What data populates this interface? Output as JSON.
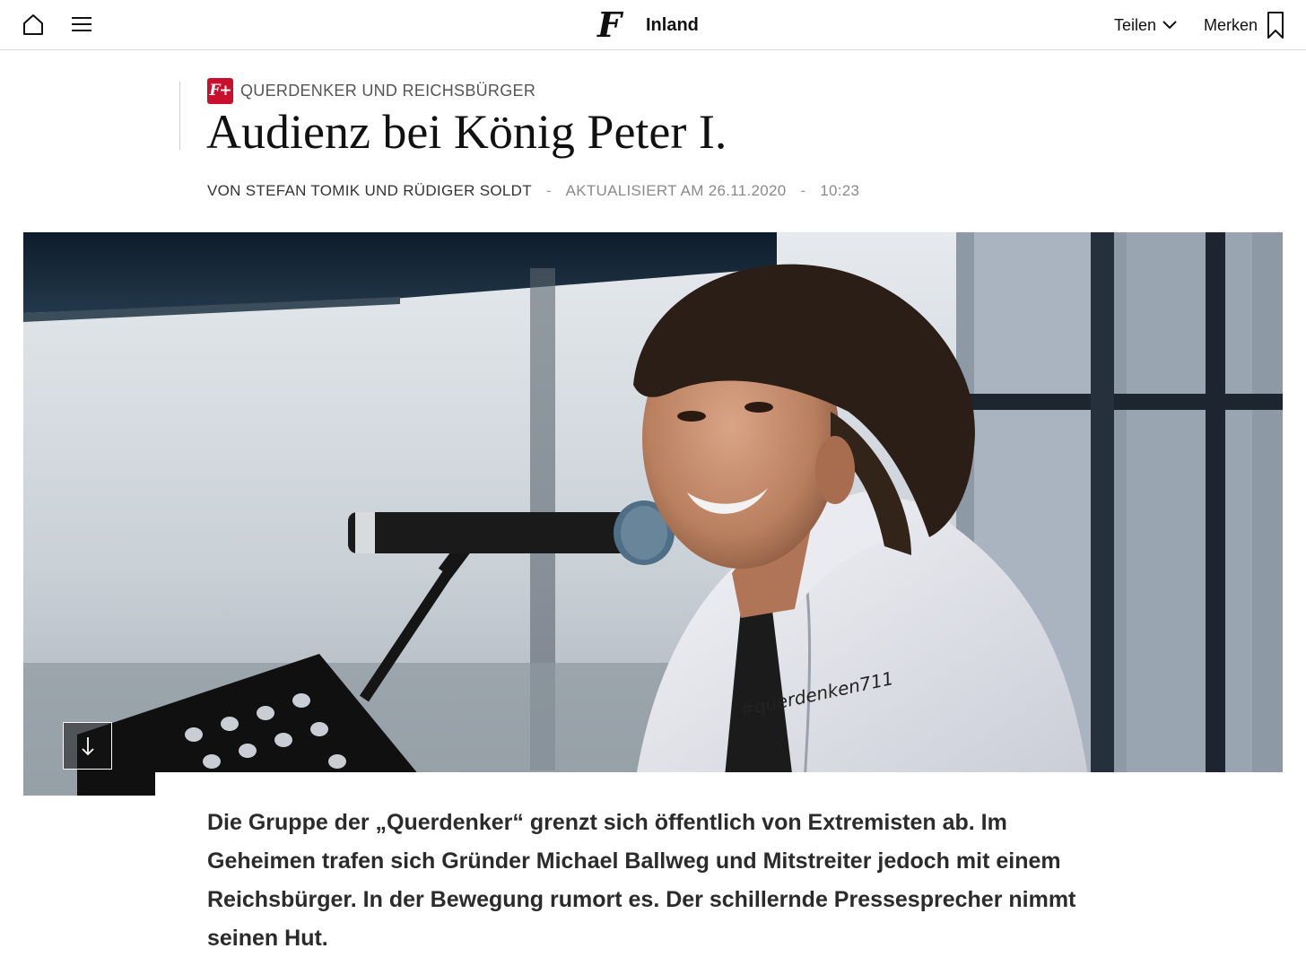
{
  "topbar": {
    "home_icon": "home-icon",
    "menu_icon": "hamburger-menu-icon",
    "brand_logo": "F",
    "section": "Inland",
    "share_label": "Teilen",
    "share_icon": "chevron-down-icon",
    "save_label": "Merken",
    "save_icon": "bookmark-icon"
  },
  "article": {
    "premium_badge": "F+",
    "kicker": "QUERDENKER UND REICHSBÜRGER",
    "headline": "Audienz bei König Peter I.",
    "authors": "VON STEFAN TOMIK UND RÜDIGER SOLDT",
    "separator": "-",
    "updated": "AKTUALISIERT AM 26.11.2020",
    "time": "10:23",
    "jacket_text": "#querdenken711",
    "scroll_icon": "arrow-down-icon",
    "lead": "Die Gruppe der „Querdenker“ grenzt sich öffentlich von Extremisten ab. Im Geheimen trafen sich Gründer Michael Ballweg und Mitstreiter jedoch mit einem Reichsbürger. In der Bewegung rumort es. Der schillernde Pressesprecher nimmt seinen Hut."
  },
  "colors": {
    "accent": "#c8102e",
    "text": "#111111",
    "muted": "#8a8a8a"
  }
}
